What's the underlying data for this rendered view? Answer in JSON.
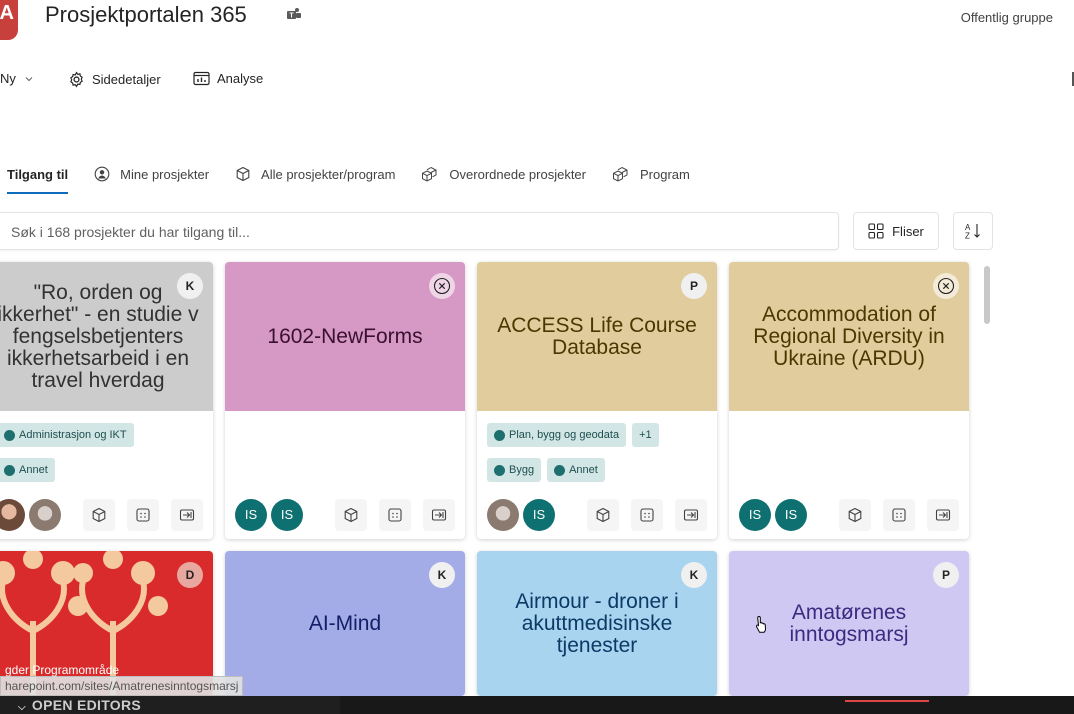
{
  "header": {
    "logo_letter": "A",
    "site_title": "Prosjektportalen 365",
    "visibility": "Offentlig gruppe"
  },
  "commandbar": {
    "new_label": "Ny",
    "details_label": "Sidedetaljer",
    "analytics_label": "Analyse"
  },
  "tabs": [
    {
      "label": "Tilgang til",
      "icon": "none",
      "active": true
    },
    {
      "label": "Mine prosjekter",
      "icon": "person-circle-icon"
    },
    {
      "label": "Alle prosjekter/program",
      "icon": "cube-icon"
    },
    {
      "label": "Overordnede prosjekter",
      "icon": "cubes-icon"
    },
    {
      "label": "Program",
      "icon": "cubes-icon"
    }
  ],
  "search": {
    "placeholder": "Søk i 168 prosjekter du har tilgang til..."
  },
  "view_button_label": "Fliser",
  "cards": [
    {
      "title": "\"Ro, orden og sikkerhet\" - en studie av fengselsbetjenters sikkerhetsarbeid i en travel hverdag",
      "title_visible": "\"Ro, orden og ikkerhet\" - en studie v fengselsbetjenters ikkerhetsarbeid i en travel hverdag",
      "badge": "K",
      "tags": [
        "Administrasjon og IKT",
        "Annet"
      ],
      "avatars": [
        "photo",
        "photo"
      ],
      "color": "#cccccc",
      "text_color": "#323232"
    },
    {
      "title": "1602-NewForms",
      "badge": "close",
      "tags": [],
      "avatars": [
        "IS",
        "IS"
      ],
      "color": "#d698c4",
      "text_color": "#3a1030"
    },
    {
      "title": "ACCESS Life Course Database",
      "badge": "P",
      "tags": [
        "Plan, bygg og geodata",
        "+1",
        "Bygg",
        "Annet"
      ],
      "avatars": [
        "photo",
        "IS"
      ],
      "color": "#e0cc9c",
      "text_color": "#4a3800"
    },
    {
      "title": "Accommodation of Regional Diversity in Ukraine (ARDU)",
      "badge": "close",
      "tags": [],
      "avatars": [
        "IS",
        "IS"
      ],
      "color": "#e0cc9c",
      "text_color": "#4a3800"
    },
    {
      "title": "",
      "badge": "D",
      "color": "#d92b2b"
    },
    {
      "title": "AI-Mind",
      "badge": "K",
      "color": "#a4ace8",
      "text_color": "#141e66"
    },
    {
      "title": "Airmour - droner i akuttmedisinske tjenester",
      "badge": "K",
      "color": "#a8d4f0",
      "text_color": "#0b3a66"
    },
    {
      "title": "Amatørenes inntogsmarsj",
      "badge": "P",
      "color": "#cfc8f2",
      "text_color": "#3c2a80"
    }
  ],
  "status_overlay": {
    "program_label": "gder Programområde",
    "url_tooltip": "harepoint.com/sites/Amatrenesinntogsmarsj",
    "bottom_panel": "OPEN EDITORS"
  }
}
